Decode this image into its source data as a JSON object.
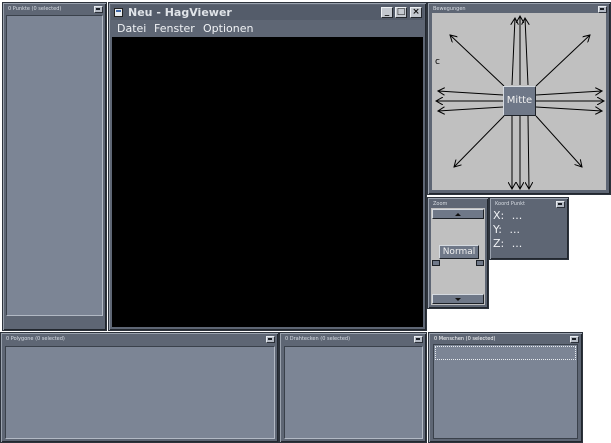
{
  "main_window": {
    "title": "Neu - HagViewer",
    "buttons": {
      "minimize": "_",
      "maximize": "□",
      "close": "×"
    },
    "menu": [
      "Datei",
      "Fenster",
      "Optionen"
    ]
  },
  "panels": {
    "punkte": {
      "title": "0 Punkte (0 selected)"
    },
    "polygone": {
      "title": "0 Polygone (0 selected)"
    },
    "drahtecken": {
      "title": "0 Drahtecken (0 selected)"
    },
    "menschen": {
      "title": "0 Menschen (0 selected)"
    },
    "bewegungen": {
      "title": "Bewegungen",
      "center_label": "Mitte",
      "corner_glyph": "c"
    },
    "zoom": {
      "title": "Zoom",
      "normal_label": "Normal"
    },
    "koord": {
      "title": "Koord Punkt",
      "x_label": "X:",
      "x_value": "...",
      "y_label": "Y:",
      "y_value": "...",
      "z_label": "Z:",
      "z_value": "..."
    }
  },
  "colors": {
    "panel": "#5e6674",
    "inset": "#7c8595",
    "canvas": "#000000",
    "gray": "#c0c0c0"
  }
}
